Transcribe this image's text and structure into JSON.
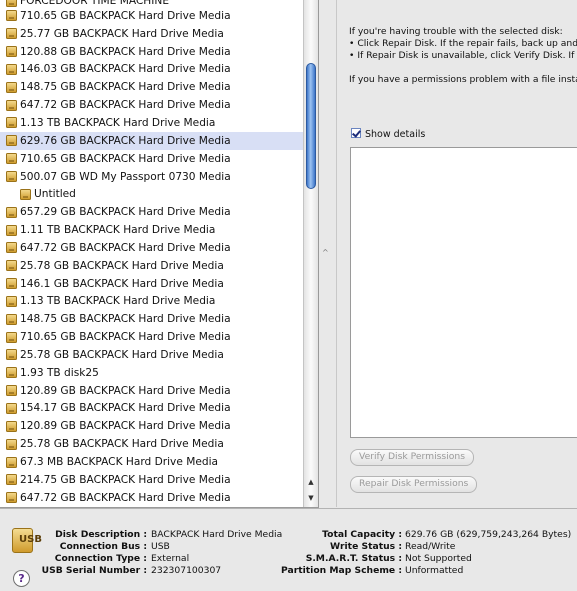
{
  "disk_list": {
    "partial_top_label": "FORCEDOOR TIME MACHINE",
    "items": [
      {
        "label": "710.65 GB BACKPACK Hard Drive Media"
      },
      {
        "label": "25.77 GB BACKPACK Hard Drive Media"
      },
      {
        "label": "120.88 GB BACKPACK Hard Drive Media"
      },
      {
        "label": "146.03 GB BACKPACK Hard Drive Media"
      },
      {
        "label": "148.75 GB BACKPACK Hard Drive Media"
      },
      {
        "label": "647.72 GB BACKPACK Hard Drive Media"
      },
      {
        "label": "1.13 TB BACKPACK Hard Drive Media"
      },
      {
        "label": "629.76 GB BACKPACK Hard Drive Media",
        "selected": true
      },
      {
        "label": "710.65 GB BACKPACK Hard Drive Media"
      },
      {
        "label": "500.07 GB WD My Passport 0730 Media"
      },
      {
        "label": "Untitled",
        "volume": true
      },
      {
        "label": "657.29 GB BACKPACK Hard Drive Media"
      },
      {
        "label": "1.11 TB BACKPACK Hard Drive Media"
      },
      {
        "label": "647.72 GB BACKPACK Hard Drive Media"
      },
      {
        "label": "25.78 GB BACKPACK Hard Drive Media"
      },
      {
        "label": "146.1 GB BACKPACK Hard Drive Media"
      },
      {
        "label": "1.13 TB BACKPACK Hard Drive Media"
      },
      {
        "label": "148.75 GB BACKPACK Hard Drive Media"
      },
      {
        "label": "710.65 GB BACKPACK Hard Drive Media"
      },
      {
        "label": "25.78 GB BACKPACK Hard Drive Media"
      },
      {
        "label": "1.93 TB disk25"
      },
      {
        "label": "120.89 GB BACKPACK Hard Drive Media"
      },
      {
        "label": "154.17 GB BACKPACK Hard Drive Media"
      },
      {
        "label": "120.89 GB BACKPACK Hard Drive Media"
      },
      {
        "label": "25.78 GB BACKPACK Hard Drive Media"
      },
      {
        "label": "67.3 MB BACKPACK Hard Drive Media"
      },
      {
        "label": "214.75 GB BACKPACK Hard Drive Media"
      },
      {
        "label": "647.72 GB BACKPACK Hard Drive Media"
      }
    ],
    "scroll_up_icon": "triangle-up-icon",
    "scroll_down_icon": "triangle-down-icon"
  },
  "first_aid": {
    "line1": "If you're having trouble with the selected disk:",
    "line2": "• Click Repair Disk. If the repair fails, back up and",
    "line3": "• If Repair Disk is unavailable, click Verify Disk. If",
    "line4": "If you have a permissions problem with a file insta",
    "show_details_label": "Show details",
    "show_details_checked": true,
    "verify_button": "Verify Disk Permissions",
    "repair_button": "Repair Disk Permissions"
  },
  "info": {
    "left_labels": [
      "Disk Description :",
      "Connection Bus :",
      "Connection Type :",
      "USB Serial Number :"
    ],
    "left_values": [
      "BACKPACK Hard Drive Media",
      "USB",
      "External",
      "232307100307"
    ],
    "right_labels": [
      "Total Capacity :",
      "Write Status :",
      "S.M.A.R.T. Status :",
      "Partition Map Scheme :"
    ],
    "right_values": [
      "629.76 GB (629,759,243,264 Bytes)",
      "Read/Write",
      "Not Supported",
      "Unformatted"
    ],
    "disk_icon_text": "USB",
    "help_glyph": "?"
  },
  "colors": {
    "selection": "#d8dff5",
    "scroll_thumb": "#3e75c8"
  }
}
